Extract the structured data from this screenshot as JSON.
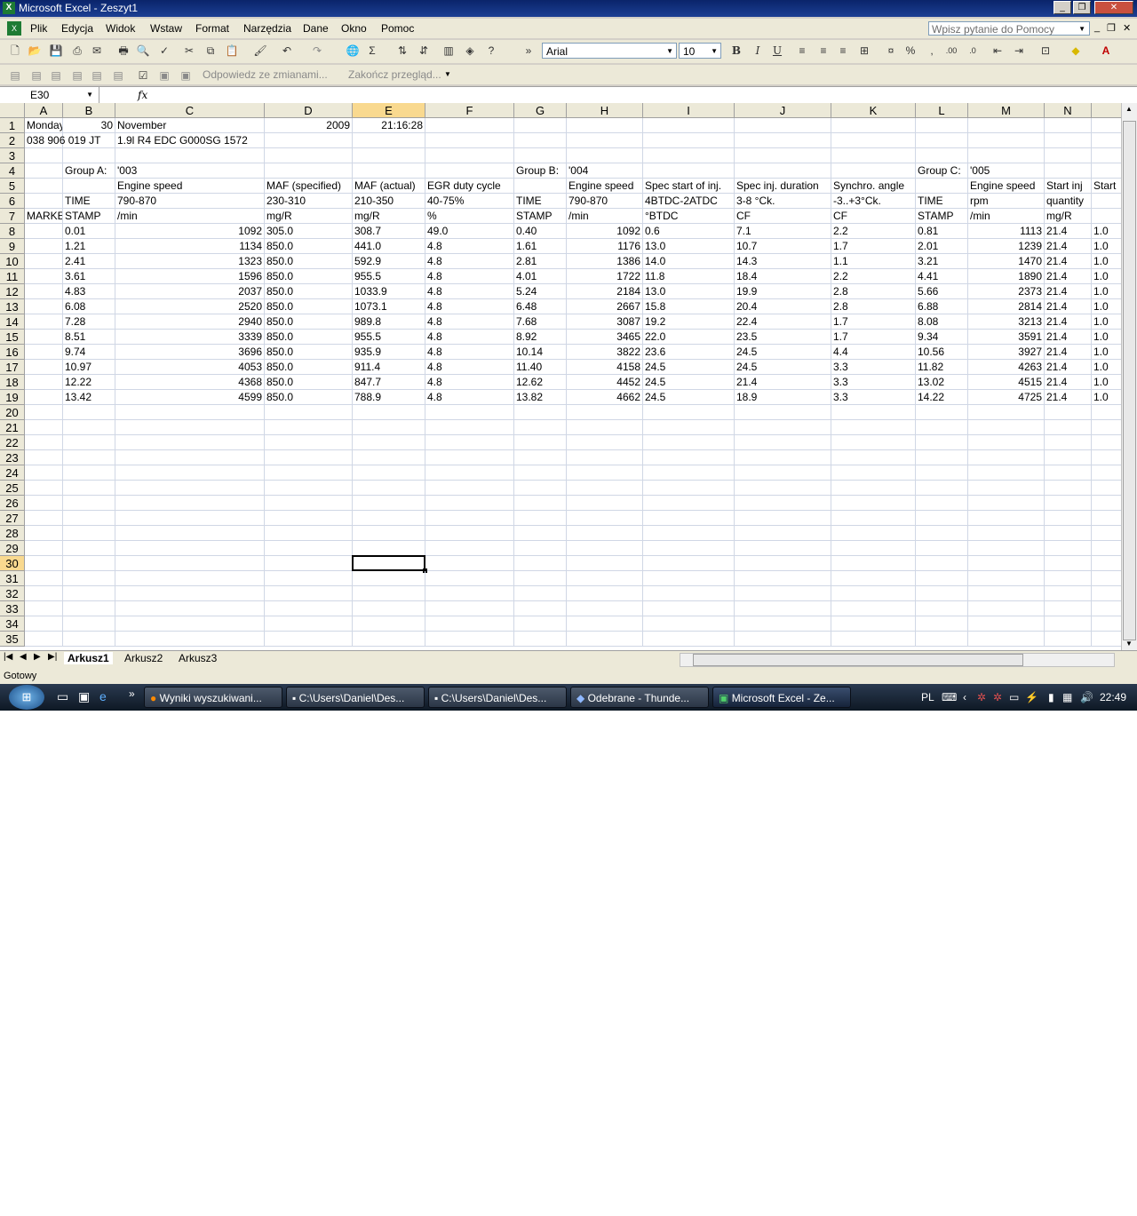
{
  "window": {
    "title": "Microsoft Excel - Zeszyt1",
    "icon": "excel-icon",
    "controls": [
      "_",
      "❐",
      "✕"
    ]
  },
  "menu": {
    "items": [
      "Plik",
      "Edycja",
      "Widok",
      "Wstaw",
      "Format",
      "Narzędzia",
      "Dane",
      "Okno",
      "Pomoc"
    ],
    "help_placeholder": "Wpisz pytanie do Pomocy",
    "mdi_controls": [
      "_",
      "❐",
      "✕"
    ]
  },
  "format_toolbar": {
    "font": "Arial",
    "size": "10",
    "bold": "B",
    "italic": "I",
    "underline": "U",
    "percent": "%",
    "comma": ","
  },
  "review_toolbar": {
    "reply": "Odpowiedz ze zmianami...",
    "end_review": "Zakończ przegląd..."
  },
  "formula_bar": {
    "name_box": "E30",
    "fx": "fx",
    "value": ""
  },
  "columns": [
    "A",
    "B",
    "C",
    "D",
    "E",
    "F",
    "G",
    "H",
    "I",
    "J",
    "K",
    "L",
    "M",
    "N",
    ""
  ],
  "rows": [
    "1",
    "2",
    "3",
    "4",
    "5",
    "6",
    "7",
    "8",
    "9",
    "10",
    "11",
    "12",
    "13",
    "14",
    "15",
    "16",
    "17",
    "18",
    "19",
    "20",
    "21",
    "22",
    "23",
    "24",
    "25",
    "26",
    "27",
    "28",
    "29",
    "30",
    "31",
    "32",
    "33",
    "34",
    "35"
  ],
  "cells": {
    "1": {
      "A": "Monday",
      "B": "30",
      "C": "November",
      "D": "2009",
      "E": "21:16:28"
    },
    "2": {
      "A": "038 906 019 JT",
      "C": "1.9l R4 EDC G000SG  1572"
    },
    "4": {
      "B": "Group A:",
      "C": "'003",
      "G": "Group B:",
      "H": "'004",
      "L": "Group C:",
      "M": "'005"
    },
    "5": {
      "C": "Engine speed",
      "D": "MAF (specified)",
      "E": "MAF (actual)",
      "F": "EGR duty cycle",
      "H": "Engine speed",
      "I": "Spec start of inj.",
      "J": "Spec inj. duration",
      "K": "Synchro. angle",
      "M": "Engine speed",
      "N": "Start inj",
      "O": "Start"
    },
    "6": {
      "B": "TIME",
      "C": "790-870",
      "D": "230-310",
      "E": "210-350",
      "F": "40-75%",
      "G": "TIME",
      "H": "790-870",
      "I": "4BTDC-2ATDC",
      "J": "3-8 °Ck.",
      "K": "-3..+3°Ck.",
      "L": "TIME",
      "M": "rpm",
      "N": "quantity"
    },
    "7": {
      "A": "MARKER",
      "B": "STAMP",
      "C": " /min",
      "D": " mg/R",
      "E": " mg/R",
      "F": " %",
      "G": "STAMP",
      "H": " /min",
      "I": " °BTDC",
      "J": " CF",
      "K": " CF",
      "L": "STAMP",
      "M": " /min",
      "N": " mg/R"
    },
    "8": {
      "B": "0.01",
      "C": "1092",
      "D": "305.0",
      "E": "308.7",
      "F": "49.0",
      "G": "0.40",
      "H": "1092",
      "I": "0.6",
      "J": "7.1",
      "K": "2.2",
      "L": "0.81",
      "M": "1113",
      "N": "21.4",
      "O": "1.0"
    },
    "9": {
      "B": "1.21",
      "C": "1134",
      "D": "850.0",
      "E": "441.0",
      "F": "4.8",
      "G": "1.61",
      "H": "1176",
      "I": "13.0",
      "J": "10.7",
      "K": "1.7",
      "L": "2.01",
      "M": "1239",
      "N": "21.4",
      "O": "1.0"
    },
    "10": {
      "B": "2.41",
      "C": "1323",
      "D": "850.0",
      "E": "592.9",
      "F": "4.8",
      "G": "2.81",
      "H": "1386",
      "I": "14.0",
      "J": "14.3",
      "K": "1.1",
      "L": "3.21",
      "M": "1470",
      "N": "21.4",
      "O": "1.0"
    },
    "11": {
      "B": "3.61",
      "C": "1596",
      "D": "850.0",
      "E": "955.5",
      "F": "4.8",
      "G": "4.01",
      "H": "1722",
      "I": "11.8",
      "J": "18.4",
      "K": "2.2",
      "L": "4.41",
      "M": "1890",
      "N": "21.4",
      "O": "1.0"
    },
    "12": {
      "B": "4.83",
      "C": "2037",
      "D": "850.0",
      "E": "1033.9",
      "F": "4.8",
      "G": "5.24",
      "H": "2184",
      "I": "13.0",
      "J": "19.9",
      "K": "2.8",
      "L": "5.66",
      "M": "2373",
      "N": "21.4",
      "O": "1.0"
    },
    "13": {
      "B": "6.08",
      "C": "2520",
      "D": "850.0",
      "E": "1073.1",
      "F": "4.8",
      "G": "6.48",
      "H": "2667",
      "I": "15.8",
      "J": "20.4",
      "K": "2.8",
      "L": "6.88",
      "M": "2814",
      "N": "21.4",
      "O": "1.0"
    },
    "14": {
      "B": "7.28",
      "C": "2940",
      "D": "850.0",
      "E": "989.8",
      "F": "4.8",
      "G": "7.68",
      "H": "3087",
      "I": "19.2",
      "J": "22.4",
      "K": "1.7",
      "L": "8.08",
      "M": "3213",
      "N": "21.4",
      "O": "1.0"
    },
    "15": {
      "B": "8.51",
      "C": "3339",
      "D": "850.0",
      "E": "955.5",
      "F": "4.8",
      "G": "8.92",
      "H": "3465",
      "I": "22.0",
      "J": "23.5",
      "K": "1.7",
      "L": "9.34",
      "M": "3591",
      "N": "21.4",
      "O": "1.0"
    },
    "16": {
      "B": "9.74",
      "C": "3696",
      "D": "850.0",
      "E": "935.9",
      "F": "4.8",
      "G": "10.14",
      "H": "3822",
      "I": "23.6",
      "J": "24.5",
      "K": "4.4",
      "L": "10.56",
      "M": "3927",
      "N": "21.4",
      "O": "1.0"
    },
    "17": {
      "B": "10.97",
      "C": "4053",
      "D": "850.0",
      "E": "911.4",
      "F": "4.8",
      "G": "11.40",
      "H": "4158",
      "I": "24.5",
      "J": "24.5",
      "K": "3.3",
      "L": "11.82",
      "M": "4263",
      "N": "21.4",
      "O": "1.0"
    },
    "18": {
      "B": "12.22",
      "C": "4368",
      "D": "850.0",
      "E": "847.7",
      "F": "4.8",
      "G": "12.62",
      "H": "4452",
      "I": "24.5",
      "J": "21.4",
      "K": "3.3",
      "L": "13.02",
      "M": "4515",
      "N": "21.4",
      "O": "1.0"
    },
    "19": {
      "B": "13.42",
      "C": "4599",
      "D": "850.0",
      "E": "788.9",
      "F": "4.8",
      "G": "13.82",
      "H": "4662",
      "I": "24.5",
      "J": "18.9",
      "K": "3.3",
      "L": "14.22",
      "M": "4725",
      "N": "21.4",
      "O": "1.0"
    }
  },
  "right_aligned": {
    "1": [
      "B",
      "D",
      "E"
    ],
    "8": [
      "C",
      "H",
      "M"
    ],
    "9": [
      "C",
      "H",
      "M"
    ],
    "10": [
      "C",
      "H",
      "M"
    ],
    "11": [
      "C",
      "H",
      "M"
    ],
    "12": [
      "C",
      "H",
      "M"
    ],
    "13": [
      "C",
      "H",
      "M"
    ],
    "14": [
      "C",
      "H",
      "M"
    ],
    "15": [
      "C",
      "H",
      "M"
    ],
    "16": [
      "C",
      "H",
      "M"
    ],
    "17": [
      "C",
      "H",
      "M"
    ],
    "18": [
      "C",
      "H",
      "M"
    ],
    "19": [
      "C",
      "H",
      "M"
    ]
  },
  "active_cell": {
    "col": "E",
    "row": "30"
  },
  "sheets": {
    "tabs": [
      "Arkusz1",
      "Arkusz2",
      "Arkusz3"
    ],
    "active": "Arkusz1",
    "nav": [
      "|◀",
      "◀",
      "▶",
      "▶|"
    ]
  },
  "status": "Gotowy",
  "taskbar": {
    "start": "start-orb-icon",
    "quick_launch_more": "»",
    "buttons": [
      {
        "label": "Wyniki wyszukiwani...",
        "icon": "firefox-icon"
      },
      {
        "label": "C:\\Users\\Daniel\\Des...",
        "icon": "cmd-icon"
      },
      {
        "label": "C:\\Users\\Daniel\\Des...",
        "icon": "cmd-icon"
      },
      {
        "label": "Odebrane - Thunde...",
        "icon": "thunderbird-icon"
      },
      {
        "label": "Microsoft Excel - Ze...",
        "icon": "excel-icon",
        "active": true
      }
    ],
    "lang": "PL",
    "clock": "22:49"
  }
}
